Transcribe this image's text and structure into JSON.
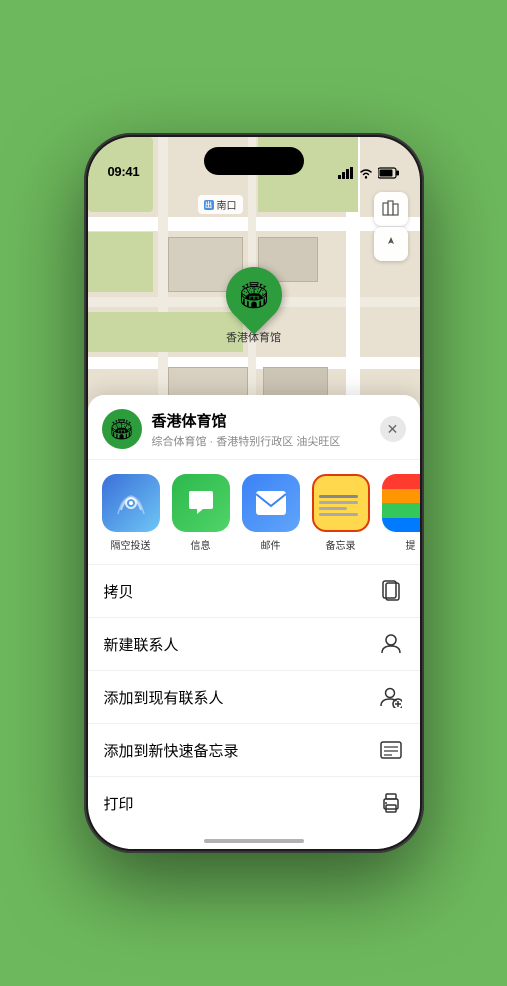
{
  "status_bar": {
    "time": "09:41",
    "location_icon": "▶"
  },
  "map": {
    "label_text": "南口",
    "venue_pin_name": "香港体育馆",
    "venue_pin_emoji": "🏟"
  },
  "sheet": {
    "venue_name": "香港体育馆",
    "venue_subtitle": "综合体育馆 · 香港特别行政区 油尖旺区",
    "close_label": "✕",
    "share_items": [
      {
        "id": "airdrop",
        "label": "隔空投送",
        "emoji": "📡"
      },
      {
        "id": "message",
        "label": "信息",
        "emoji": "💬"
      },
      {
        "id": "mail",
        "label": "邮件",
        "emoji": "✉️"
      },
      {
        "id": "notes",
        "label": "备忘录",
        "emoji": ""
      },
      {
        "id": "more",
        "label": "提",
        "emoji": "⋯"
      }
    ],
    "actions": [
      {
        "id": "copy",
        "label": "拷贝",
        "icon": "copy"
      },
      {
        "id": "add-contact",
        "label": "新建联系人",
        "icon": "person"
      },
      {
        "id": "add-existing",
        "label": "添加到现有联系人",
        "icon": "person-add"
      },
      {
        "id": "add-note",
        "label": "添加到新快速备忘录",
        "icon": "note"
      },
      {
        "id": "print",
        "label": "打印",
        "icon": "print"
      }
    ]
  }
}
